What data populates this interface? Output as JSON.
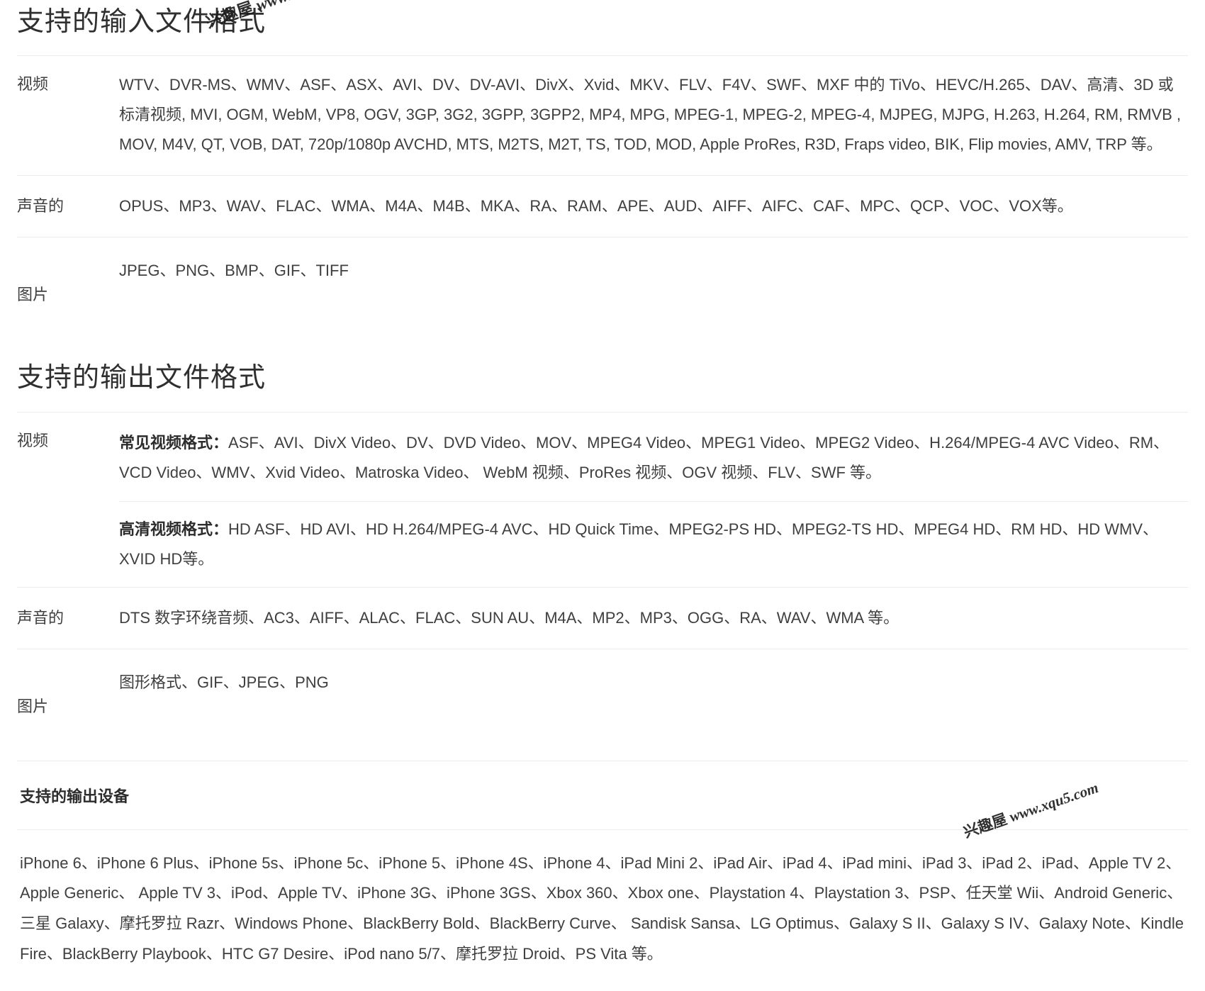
{
  "sections": {
    "input": {
      "title": "支持的输入文件格式",
      "rows": [
        {
          "label": "视频",
          "text": "WTV、DVR-MS、WMV、ASF、ASX、AVI、DV、DV-AVI、DivX、Xvid、MKV、FLV、F4V、SWF、MXF 中的 TiVo、HEVC/H.265、DAV、高清、3D 或标清视频, MVI, OGM, WebM, VP8, OGV, 3GP, 3G2, 3GPP, 3GPP2, MP4, MPG, MPEG-1, MPEG-2, MPEG-4, MJPEG, MJPG, H.263, H.264, RM, RMVB , MOV, M4V, QT, VOB, DAT, 720p/1080p AVCHD, MTS, M2TS, M2T, TS, TOD, MOD, Apple ProRes, R3D, Fraps video, BIK, Flip movies, AMV, TRP 等。"
        },
        {
          "label": "声音的",
          "text": "OPUS、MP3、WAV、FLAC、WMA、M4A、M4B、MKA、RA、RAM、APE、AUD、AIFF、AIFC、CAF、MPC、QCP、VOC、VOX等。"
        },
        {
          "label": "图片",
          "text": "JPEG、PNG、BMP、GIF、TIFF"
        }
      ]
    },
    "output": {
      "title": "支持的输出文件格式",
      "video": {
        "label": "视频",
        "common_label": "常见视频格式：",
        "common_text": "ASF、AVI、DivX Video、DV、DVD Video、MOV、MPEG4 Video、MPEG1 Video、MPEG2 Video、H.264/MPEG-4 AVC Video、RM、VCD Video、WMV、Xvid Video、Matroska Video、 WebM 视频、ProRes 视频、OGV 视频、FLV、SWF 等。",
        "hd_label": "高清视频格式：",
        "hd_text": "HD ASF、HD AVI、HD H.264/MPEG-4 AVC、HD Quick Time、MPEG2-PS HD、MPEG2-TS HD、MPEG4 HD、RM HD、HD WMV、XVID HD等。"
      },
      "audio": {
        "label": "声音的",
        "text": "DTS 数字环绕音频、AC3、AIFF、ALAC、FLAC、SUN AU、M4A、MP2、MP3、OGG、RA、WAV、WMA 等。"
      },
      "image": {
        "label": "图片",
        "text": "图形格式、GIF、JPEG、PNG"
      }
    },
    "devices": {
      "title": "支持的输出设备",
      "text": "iPhone 6、iPhone 6 Plus、iPhone 5s、iPhone 5c、iPhone 5、iPhone 4S、iPhone 4、iPad Mini 2、iPad Air、iPad 4、iPad mini、iPad 3、iPad 2、iPad、Apple TV 2、Apple Generic、 Apple TV 3、iPod、Apple TV、iPhone 3G、iPhone 3GS、Xbox 360、Xbox one、Playstation 4、Playstation 3、PSP、任天堂 Wii、Android Generic、三星 Galaxy、摩托罗拉 Razr、Windows Phone、BlackBerry Bold、BlackBerry Curve、 Sandisk Sansa、LG Optimus、Galaxy S II、Galaxy S IV、Galaxy Note、Kindle Fire、BlackBerry Playbook、HTC G7 Desire、iPod nano 5/7、摩托罗拉 Droid、PS Vita 等。"
    }
  },
  "watermark": {
    "cn": "兴趣屋",
    "url": "www.xqu5.com"
  },
  "colors": {
    "text": "#3f3f3f",
    "heading": "#2f2f2f",
    "divider": "#ececec",
    "background": "#ffffff"
  }
}
